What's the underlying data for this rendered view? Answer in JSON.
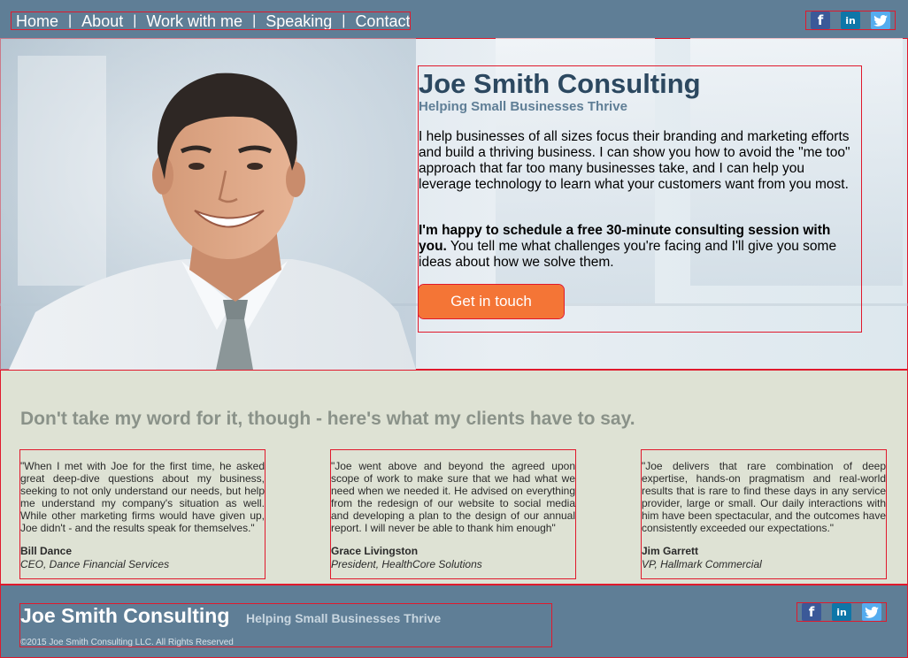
{
  "nav": {
    "items": [
      {
        "label": "Home"
      },
      {
        "label": "About"
      },
      {
        "label": "Work with me"
      },
      {
        "label": "Speaking"
      },
      {
        "label": "Contact"
      }
    ],
    "separator": "|"
  },
  "social": {
    "facebook": "f",
    "linkedin": "in",
    "twitter": "🐦"
  },
  "hero": {
    "title": "Joe Smith Consulting",
    "subtitle": "Helping Small Businesses Thrive",
    "paragraph1": "I help businesses of all sizes focus their branding and marketing efforts and build a thriving business. I can show you how to avoid the \"me too\" approach that far too many businesses take, and I can help you leverage technology to learn what your customers want from you most.",
    "paragraph2_bold": "I'm happy to schedule a free 30-minute consulting session with you.",
    "paragraph2_rest": " You tell me what challenges you're facing and I'll give you some ideas about how we solve them.",
    "cta_label": "Get in touch"
  },
  "testimonials": {
    "heading": "Don't take my word for it, though - here's what my clients have to say.",
    "items": [
      {
        "quote": "\"When I met with Joe for the first time, he asked great deep-dive questions about my business, seeking to not only understand our needs, but help me understand my company's situation as well. While other marketing firms would have given up, Joe didn't - and the results speak for themselves.\"",
        "name": "Bill Dance",
        "role": "CEO, Dance Financial Services"
      },
      {
        "quote": "\"Joe went above and beyond the agreed upon scope of work to make sure that we had what we need when we needed it. He advised on everything from the redesign of our website to social media and developing a plan to the design of our annual report. I will never be able to thank him enough\"",
        "name": "Grace Livingston",
        "role": "President, HealthCore Solutions"
      },
      {
        "quote": "\"Joe delivers that rare combination of deep expertise, hands-on pragmatism and real-world results that is rare to find these days in any service provider, large or small. Our daily interactions with him have been spectacular, and the outcomes have consistently exceeded our expectations.\"",
        "name": "Jim Garrett",
        "role": "VP, Hallmark Commercial"
      }
    ]
  },
  "footer": {
    "title": "Joe Smith Consulting",
    "tagline": "Helping Small Businesses Thrive",
    "copyright": "©2015 Joe Smith Consulting LLC. All Rights Reserved"
  },
  "colors": {
    "header_bg": "#5f7e96",
    "accent_orange": "#f47536",
    "title_navy": "#2c4860",
    "testimonials_bg": "#dee2d4"
  }
}
